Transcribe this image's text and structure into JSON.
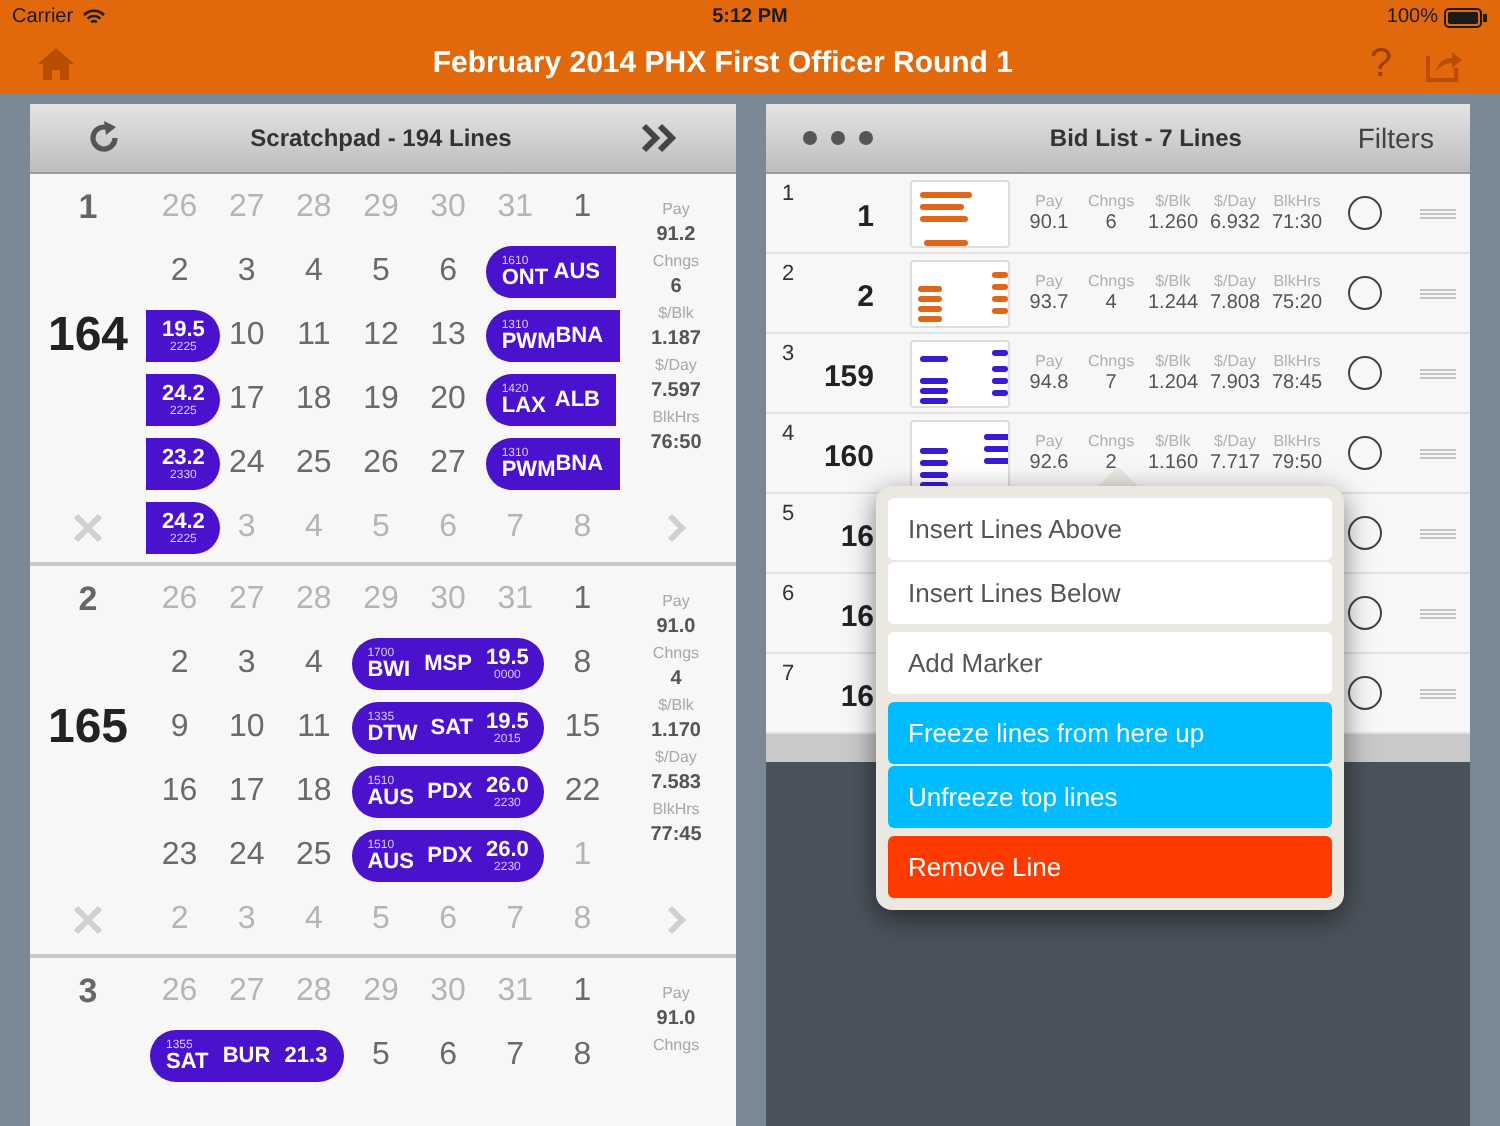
{
  "status_bar": {
    "carrier": "Carrier",
    "time": "5:12 PM",
    "battery": "100%"
  },
  "nav_bar": {
    "title": "February 2014 PHX First Officer Round 1",
    "help": "?"
  },
  "scratchpad": {
    "title": "Scratchpad - 194 Lines",
    "lines": [
      {
        "index": "1",
        "number": "164",
        "stats": [
          {
            "label": "Pay",
            "value": "91.2"
          },
          {
            "label": "Chngs",
            "value": "6"
          },
          {
            "label": "$/Blk",
            "value": "1.187"
          },
          {
            "label": "$/Day",
            "value": "7.597"
          },
          {
            "label": "BlkHrs",
            "value": "76:50"
          }
        ],
        "rows": [
          [
            {
              "kind": "day",
              "text": "26",
              "muted": true
            },
            {
              "kind": "day",
              "text": "27",
              "muted": true
            },
            {
              "kind": "day",
              "text": "28",
              "muted": true
            },
            {
              "kind": "day",
              "text": "29",
              "muted": true
            },
            {
              "kind": "day",
              "text": "30",
              "muted": true
            },
            {
              "kind": "day",
              "text": "31",
              "muted": true
            },
            {
              "kind": "day",
              "text": "1",
              "muted": false
            }
          ],
          [
            {
              "kind": "day",
              "text": "2",
              "muted": false
            },
            {
              "kind": "day",
              "text": "3",
              "muted": false
            },
            {
              "kind": "day",
              "text": "4",
              "muted": false
            },
            {
              "kind": "day",
              "text": "5",
              "muted": false
            },
            {
              "kind": "day",
              "text": "6",
              "muted": false
            },
            {
              "kind": "trip",
              "open_start": false,
              "open_end": true,
              "start_time": "1610",
              "codes": [
                "ONT",
                "AUS"
              ]
            },
            {
              "kind": "continued"
            }
          ],
          [
            {
              "kind": "trip",
              "open_start": true,
              "open_end": false,
              "pay": "19.5",
              "end_time": "2225"
            },
            {
              "kind": "day",
              "text": "10",
              "muted": false
            },
            {
              "kind": "day",
              "text": "11",
              "muted": false
            },
            {
              "kind": "day",
              "text": "12",
              "muted": false
            },
            {
              "kind": "day",
              "text": "13",
              "muted": false
            },
            {
              "kind": "trip",
              "open_start": false,
              "open_end": true,
              "start_time": "1310",
              "codes": [
                "PWM",
                "BNA"
              ]
            },
            {
              "kind": "continued"
            }
          ],
          [
            {
              "kind": "trip",
              "open_start": true,
              "open_end": false,
              "pay": "24.2",
              "end_time": "2225"
            },
            {
              "kind": "day",
              "text": "17",
              "muted": false
            },
            {
              "kind": "day",
              "text": "18",
              "muted": false
            },
            {
              "kind": "day",
              "text": "19",
              "muted": false
            },
            {
              "kind": "day",
              "text": "20",
              "muted": false
            },
            {
              "kind": "trip",
              "open_start": false,
              "open_end": true,
              "start_time": "1420",
              "codes": [
                "LAX",
                "ALB"
              ]
            },
            {
              "kind": "continued"
            }
          ],
          [
            {
              "kind": "trip",
              "open_start": true,
              "open_end": false,
              "pay": "23.2",
              "end_time": "2330"
            },
            {
              "kind": "day",
              "text": "24",
              "muted": false
            },
            {
              "kind": "day",
              "text": "25",
              "muted": false
            },
            {
              "kind": "day",
              "text": "26",
              "muted": false
            },
            {
              "kind": "day",
              "text": "27",
              "muted": false
            },
            {
              "kind": "trip",
              "open_start": false,
              "open_end": true,
              "start_time": "1310",
              "codes": [
                "PWM",
                "BNA"
              ]
            },
            {
              "kind": "continued"
            }
          ],
          [
            {
              "kind": "trip",
              "open_start": true,
              "open_end": false,
              "pay": "24.2",
              "end_time": "2225"
            },
            {
              "kind": "day",
              "text": "3",
              "muted": true
            },
            {
              "kind": "day",
              "text": "4",
              "muted": true
            },
            {
              "kind": "day",
              "text": "5",
              "muted": true
            },
            {
              "kind": "day",
              "text": "6",
              "muted": true
            },
            {
              "kind": "day",
              "text": "7",
              "muted": true
            },
            {
              "kind": "day",
              "text": "8",
              "muted": true
            }
          ]
        ]
      },
      {
        "index": "2",
        "number": "165",
        "stats": [
          {
            "label": "Pay",
            "value": "91.0"
          },
          {
            "label": "Chngs",
            "value": "4"
          },
          {
            "label": "$/Blk",
            "value": "1.170"
          },
          {
            "label": "$/Day",
            "value": "7.583"
          },
          {
            "label": "BlkHrs",
            "value": "77:45"
          }
        ],
        "rows": [
          [
            {
              "kind": "day",
              "text": "26",
              "muted": true
            },
            {
              "kind": "day",
              "text": "27",
              "muted": true
            },
            {
              "kind": "day",
              "text": "28",
              "muted": true
            },
            {
              "kind": "day",
              "text": "29",
              "muted": true
            },
            {
              "kind": "day",
              "text": "30",
              "muted": true
            },
            {
              "kind": "day",
              "text": "31",
              "muted": true
            },
            {
              "kind": "day",
              "text": "1",
              "muted": false
            }
          ],
          [
            {
              "kind": "day",
              "text": "2",
              "muted": false
            },
            {
              "kind": "day",
              "text": "3",
              "muted": false
            },
            {
              "kind": "day",
              "text": "4",
              "muted": false
            },
            {
              "kind": "trip",
              "open_start": false,
              "open_end": false,
              "start_time": "1700",
              "codes": [
                "BWI",
                "MSP"
              ],
              "pay": "19.5",
              "end_time": "0000"
            },
            {
              "kind": "continued"
            },
            {
              "kind": "continued"
            },
            {
              "kind": "day",
              "text": "8",
              "muted": false
            }
          ],
          [
            {
              "kind": "day",
              "text": "9",
              "muted": false
            },
            {
              "kind": "day",
              "text": "10",
              "muted": false
            },
            {
              "kind": "day",
              "text": "11",
              "muted": false
            },
            {
              "kind": "trip",
              "open_start": false,
              "open_end": false,
              "start_time": "1335",
              "codes": [
                "DTW",
                "SAT"
              ],
              "pay": "19.5",
              "end_time": "2015"
            },
            {
              "kind": "continued"
            },
            {
              "kind": "continued"
            },
            {
              "kind": "day",
              "text": "15",
              "muted": false
            }
          ],
          [
            {
              "kind": "day",
              "text": "16",
              "muted": false
            },
            {
              "kind": "day",
              "text": "17",
              "muted": false
            },
            {
              "kind": "day",
              "text": "18",
              "muted": false
            },
            {
              "kind": "trip",
              "open_start": false,
              "open_end": false,
              "start_time": "1510",
              "codes": [
                "AUS",
                "PDX"
              ],
              "pay": "26.0",
              "end_time": "2230"
            },
            {
              "kind": "continued"
            },
            {
              "kind": "continued"
            },
            {
              "kind": "day",
              "text": "22",
              "muted": false
            }
          ],
          [
            {
              "kind": "day",
              "text": "23",
              "muted": false
            },
            {
              "kind": "day",
              "text": "24",
              "muted": false
            },
            {
              "kind": "day",
              "text": "25",
              "muted": false
            },
            {
              "kind": "trip",
              "open_start": false,
              "open_end": false,
              "start_time": "1510",
              "codes": [
                "AUS",
                "PDX"
              ],
              "pay": "26.0",
              "end_time": "2230"
            },
            {
              "kind": "continued"
            },
            {
              "kind": "continued"
            },
            {
              "kind": "day",
              "text": "1",
              "muted": true
            }
          ],
          [
            {
              "kind": "day",
              "text": "2",
              "muted": true
            },
            {
              "kind": "day",
              "text": "3",
              "muted": true
            },
            {
              "kind": "day",
              "text": "4",
              "muted": true
            },
            {
              "kind": "day",
              "text": "5",
              "muted": true
            },
            {
              "kind": "day",
              "text": "6",
              "muted": true
            },
            {
              "kind": "day",
              "text": "7",
              "muted": true
            },
            {
              "kind": "day",
              "text": "8",
              "muted": true
            }
          ]
        ]
      },
      {
        "index": "3",
        "stats": [
          {
            "label": "Pay",
            "value": "91.0"
          },
          {
            "label": "Chngs"
          }
        ],
        "rows": [
          [
            {
              "kind": "day",
              "text": "26",
              "muted": true
            },
            {
              "kind": "day",
              "text": "27",
              "muted": true
            },
            {
              "kind": "day",
              "text": "28",
              "muted": true
            },
            {
              "kind": "day",
              "text": "29",
              "muted": true
            },
            {
              "kind": "day",
              "text": "30",
              "muted": true
            },
            {
              "kind": "day",
              "text": "31",
              "muted": true
            },
            {
              "kind": "day",
              "text": "1",
              "muted": false
            }
          ],
          [
            {
              "kind": "trip",
              "open_start": false,
              "open_end": false,
              "start_time": "1355",
              "codes": [
                "SAT",
                "BUR"
              ],
              "pay": "21.3"
            },
            {
              "kind": "continued"
            },
            {
              "kind": "continued"
            },
            {
              "kind": "day",
              "text": "5",
              "muted": false
            },
            {
              "kind": "day",
              "text": "6",
              "muted": false
            },
            {
              "kind": "day",
              "text": "7",
              "muted": false
            },
            {
              "kind": "day",
              "text": "8",
              "muted": false
            }
          ]
        ]
      }
    ]
  },
  "bid_list": {
    "title": "Bid List - 7 Lines",
    "filters": "Filters",
    "rows": [
      {
        "index": "1",
        "number": "1",
        "color": "#e0661a",
        "selected": false,
        "stats": [
          {
            "label": "Pay",
            "value": "90.1"
          },
          {
            "label": "Chngs",
            "value": "6"
          },
          {
            "label": "$/Blk",
            "value": "1.260"
          },
          {
            "label": "$/Day",
            "value": "6.932"
          },
          {
            "label": "BlkHrs",
            "value": "71:30"
          }
        ]
      },
      {
        "index": "2",
        "number": "2",
        "color": "#e0661a",
        "selected": false,
        "stats": [
          {
            "label": "Pay",
            "value": "93.7"
          },
          {
            "label": "Chngs",
            "value": "4"
          },
          {
            "label": "$/Blk",
            "value": "1.244"
          },
          {
            "label": "$/Day",
            "value": "7.808"
          },
          {
            "label": "BlkHrs",
            "value": "75:20"
          }
        ]
      },
      {
        "index": "3",
        "number": "159",
        "color": "#3a1ad0",
        "selected": false,
        "stats": [
          {
            "label": "Pay",
            "value": "94.8"
          },
          {
            "label": "Chngs",
            "value": "7"
          },
          {
            "label": "$/Blk",
            "value": "1.204"
          },
          {
            "label": "$/Day",
            "value": "7.903"
          },
          {
            "label": "BlkHrs",
            "value": "78:45"
          }
        ]
      },
      {
        "index": "4",
        "number": "160",
        "color": "#3a1ad0",
        "selected": false,
        "stats": [
          {
            "label": "Pay",
            "value": "92.6"
          },
          {
            "label": "Chngs",
            "value": "2"
          },
          {
            "label": "$/Blk",
            "value": "1.160"
          },
          {
            "label": "$/Day",
            "value": "7.717"
          },
          {
            "label": "BlkHrs",
            "value": "79:50"
          }
        ]
      },
      {
        "index": "5",
        "number": "16",
        "selected": false
      },
      {
        "index": "6",
        "number": "16",
        "selected": false
      },
      {
        "index": "7",
        "number": "16",
        "selected": false
      }
    ]
  },
  "context_menu": {
    "sections": [
      [
        {
          "label": "Insert Lines Above",
          "kind": "normal"
        },
        {
          "label": "Insert Lines Below",
          "kind": "normal"
        }
      ],
      [
        {
          "label": "Add Marker",
          "kind": "normal"
        }
      ],
      [
        {
          "label": "Freeze lines from here up",
          "kind": "highlight"
        },
        {
          "label": "Unfreeze top lines",
          "kind": "highlight"
        }
      ],
      [
        {
          "label": "Remove Line",
          "kind": "destructive"
        }
      ]
    ]
  }
}
